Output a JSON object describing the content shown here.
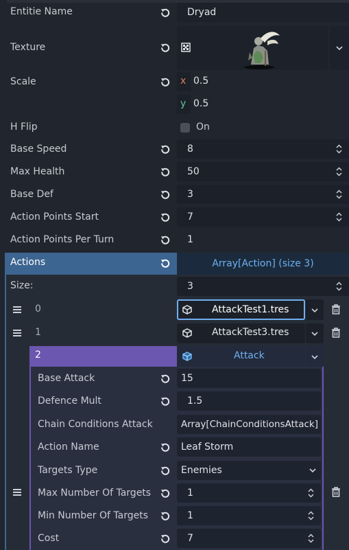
{
  "properties": {
    "entity_name": {
      "label": "Entitie Name",
      "value": "Dryad"
    },
    "texture": {
      "label": "Texture"
    },
    "scale": {
      "label": "Scale",
      "x_axis": "x",
      "x_value": "0.5",
      "y_axis": "y",
      "y_value": "0.5"
    },
    "hflip": {
      "label": "H Flip",
      "value": "On"
    },
    "base_speed": {
      "label": "Base Speed",
      "value": "8"
    },
    "max_health": {
      "label": "Max Health",
      "value": "50"
    },
    "base_def": {
      "label": "Base Def",
      "value": "3"
    },
    "ap_start": {
      "label": "Action Points Start",
      "value": "7"
    },
    "ap_per_turn": {
      "label": "Action Points Per Turn",
      "value": "1"
    }
  },
  "actions": {
    "label": "Actions",
    "summary": "Array[Action] (size 3)",
    "size_label": "Size:",
    "size_value": "3",
    "items": [
      {
        "index": "0",
        "resource": "AttackTest1.tres"
      },
      {
        "index": "1",
        "resource": "AttackTest3.tres"
      },
      {
        "index": "2",
        "resource": "Attack"
      }
    ]
  },
  "attack": {
    "base_attack": {
      "label": "Base Attack",
      "value": "15"
    },
    "defence_mult": {
      "label": "Defence Mult",
      "value": "1.5"
    },
    "chain_conditions": {
      "label": "Chain Conditions Attack",
      "value": "Array[ChainConditionsAttack]"
    },
    "action_name": {
      "label": "Action Name",
      "value": "Leaf Storm"
    },
    "targets_type": {
      "label": "Targets Type",
      "value": "Enemies"
    },
    "max_targets": {
      "label": "Max Number Of Targets",
      "value": "1"
    },
    "min_targets": {
      "label": "Min Number Of Targets",
      "value": "1"
    },
    "cost": {
      "label": "Cost",
      "value": "7"
    }
  },
  "colors": {
    "background": "#21262e",
    "field": "#1c2028",
    "actions_header": "#3d6591",
    "item_header": "#6b56b0",
    "accent": "#6fb0f2",
    "axis_x": "#d7805c",
    "axis_y": "#62c59a"
  }
}
